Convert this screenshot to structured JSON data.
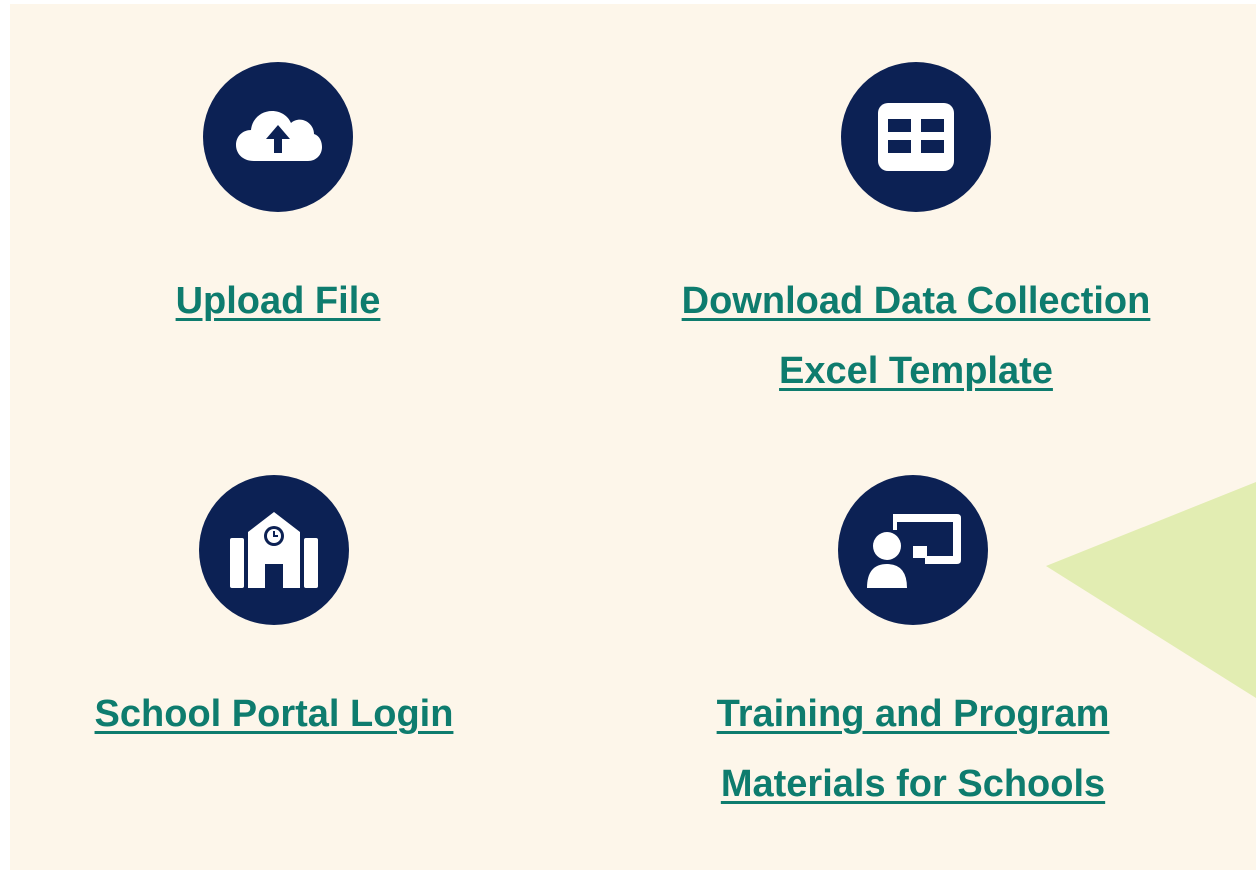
{
  "tiles": [
    {
      "id": "upload",
      "icon": "cloud-upload-icon",
      "lines": [
        "Upload File"
      ]
    },
    {
      "id": "download-template",
      "icon": "table-icon",
      "lines": [
        "Download Data Collection",
        "Excel Template"
      ]
    },
    {
      "id": "portal-login",
      "icon": "school-building-icon",
      "lines": [
        "School Portal Login"
      ]
    },
    {
      "id": "training",
      "icon": "presentation-teacher-icon",
      "lines": [
        "Training and Program",
        "Materials for Schools"
      ]
    }
  ],
  "colors": {
    "background": "#fdf6ea",
    "icon_circle": "#0c2154",
    "link": "#0e7c6e",
    "accent_triangle": "#e2edb2"
  }
}
